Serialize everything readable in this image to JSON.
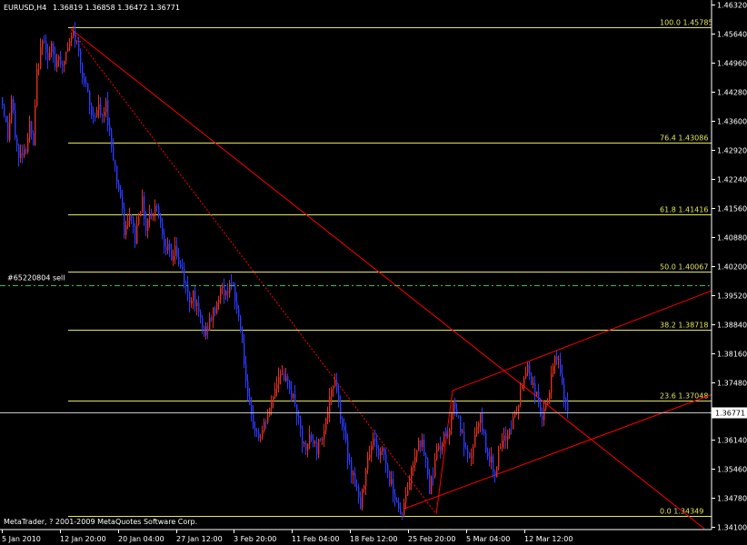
{
  "header": {
    "symbol": "EURUSD,H4",
    "ohlc": "1.36819 1.36858 1.36472 1.36771"
  },
  "footer": {
    "copyright": "MetaTrader, ? 2001-2009 MetaQuotes Software Corp."
  },
  "order_label": "#65220804 sell",
  "colors": {
    "background": "#000000",
    "axis": "#ffffff",
    "bull": "#e0301e",
    "bear": "#2a3bff",
    "fib": "#e5e55a",
    "trend": "#ff0000",
    "order": "#22c55e",
    "current": "#c8c8c8"
  },
  "chart_data": {
    "type": "candlestick",
    "title": "EURUSD,H4",
    "y_ticks": [
      "1.46320",
      "1.45640",
      "1.44960",
      "1.44280",
      "1.43600",
      "1.42920",
      "1.42240",
      "1.41560",
      "1.40880",
      "1.40200",
      "1.39520",
      "1.38840",
      "1.38160",
      "1.37480",
      "1.36800",
      "1.36140",
      "1.35460",
      "1.34780",
      "1.34100"
    ],
    "x_ticks": [
      "5 Jan 2010",
      "12 Jan 20:00",
      "20 Jan 04:00",
      "27 Jan 12:00",
      "3 Feb 20:00",
      "11 Feb 04:00",
      "18 Feb 12:00",
      "25 Feb 20:00",
      "5 Mar 04:00",
      "12 Mar 12:00"
    ],
    "ylim": [
      1.341,
      1.4632
    ],
    "fibonacci": [
      {
        "level": "100.0",
        "price": "1.45785"
      },
      {
        "level": "76.4",
        "price": "1.43086"
      },
      {
        "level": "61.8",
        "price": "1.41416"
      },
      {
        "level": "50.0",
        "price": "1.40067"
      },
      {
        "level": "38.2",
        "price": "1.38718"
      },
      {
        "level": "23.6",
        "price": "1.37048"
      },
      {
        "level": "0.0",
        "price": "1.34349"
      }
    ],
    "current_price": "1.36771",
    "order_price": "1.3975",
    "close_path": [
      [
        0,
        1.4415
      ],
      [
        4,
        1.438
      ],
      [
        8,
        1.432
      ],
      [
        12,
        1.441
      ],
      [
        16,
        1.433
      ],
      [
        20,
        1.427
      ],
      [
        24,
        1.429
      ],
      [
        28,
        1.43
      ],
      [
        32,
        1.435
      ],
      [
        36,
        1.43
      ],
      [
        40,
        1.447
      ],
      [
        44,
        1.452
      ],
      [
        48,
        1.456
      ],
      [
        52,
        1.45
      ],
      [
        56,
        1.453
      ],
      [
        60,
        1.449
      ],
      [
        64,
        1.452
      ],
      [
        68,
        1.448
      ],
      [
        72,
        1.452
      ],
      [
        76,
        1.454
      ],
      [
        80,
        1.4565
      ],
      [
        84,
        1.454
      ],
      [
        88,
        1.45
      ],
      [
        92,
        1.445
      ],
      [
        96,
        1.442
      ],
      [
        100,
        1.437
      ],
      [
        104,
        1.438
      ],
      [
        108,
        1.439
      ],
      [
        112,
        1.436
      ],
      [
        116,
        1.44
      ],
      [
        120,
        1.433
      ],
      [
        124,
        1.428
      ],
      [
        128,
        1.422
      ],
      [
        132,
        1.418
      ],
      [
        136,
        1.41
      ],
      [
        140,
        1.412
      ],
      [
        144,
        1.414
      ],
      [
        148,
        1.408
      ],
      [
        152,
        1.415
      ],
      [
        156,
        1.417
      ],
      [
        160,
        1.411
      ],
      [
        164,
        1.415
      ],
      [
        168,
        1.414
      ],
      [
        172,
        1.417
      ],
      [
        176,
        1.412
      ],
      [
        180,
        1.408
      ],
      [
        184,
        1.406
      ],
      [
        188,
        1.403
      ],
      [
        192,
        1.407
      ],
      [
        196,
        1.402
      ],
      [
        200,
        1.401
      ],
      [
        204,
        1.397
      ],
      [
        208,
        1.394
      ],
      [
        212,
        1.396
      ],
      [
        216,
        1.392
      ],
      [
        220,
        1.389
      ],
      [
        224,
        1.386
      ],
      [
        228,
        1.388
      ],
      [
        232,
        1.39
      ],
      [
        236,
        1.392
      ],
      [
        240,
        1.395
      ],
      [
        244,
        1.397
      ],
      [
        248,
        1.395
      ],
      [
        252,
        1.399
      ],
      [
        256,
        1.396
      ],
      [
        260,
        1.392
      ],
      [
        264,
        1.388
      ],
      [
        268,
        1.38
      ],
      [
        272,
        1.37
      ],
      [
        276,
        1.366
      ],
      [
        280,
        1.364
      ],
      [
        284,
        1.362
      ],
      [
        288,
        1.363
      ],
      [
        292,
        1.366
      ],
      [
        296,
        1.368
      ],
      [
        300,
        1.372
      ],
      [
        304,
        1.375
      ],
      [
        308,
        1.378
      ],
      [
        312,
        1.374
      ],
      [
        316,
        1.376
      ],
      [
        320,
        1.372
      ],
      [
        324,
        1.37
      ],
      [
        328,
        1.365
      ],
      [
        332,
        1.361
      ],
      [
        336,
        1.358
      ],
      [
        340,
        1.362
      ],
      [
        344,
        1.361
      ],
      [
        348,
        1.359
      ],
      [
        352,
        1.362
      ],
      [
        356,
        1.364
      ],
      [
        360,
        1.368
      ],
      [
        364,
        1.372
      ],
      [
        368,
        1.376
      ],
      [
        372,
        1.37
      ],
      [
        376,
        1.365
      ],
      [
        380,
        1.36
      ],
      [
        384,
        1.356
      ],
      [
        388,
        1.353
      ],
      [
        392,
        1.35
      ],
      [
        396,
        1.345
      ],
      [
        400,
        1.352
      ],
      [
        404,
        1.358
      ],
      [
        408,
        1.36
      ],
      [
        412,
        1.362
      ],
      [
        416,
        1.357
      ],
      [
        420,
        1.36
      ],
      [
        424,
        1.356
      ],
      [
        428,
        1.352
      ],
      [
        432,
        1.35
      ],
      [
        436,
        1.347
      ],
      [
        440,
        1.344
      ],
      [
        444,
        1.346
      ],
      [
        448,
        1.35
      ],
      [
        452,
        1.354
      ],
      [
        456,
        1.358
      ],
      [
        460,
        1.362
      ],
      [
        464,
        1.36
      ],
      [
        468,
        1.356
      ],
      [
        472,
        1.35
      ],
      [
        476,
        1.354
      ],
      [
        480,
        1.36
      ],
      [
        484,
        1.358
      ],
      [
        488,
        1.364
      ],
      [
        492,
        1.362
      ],
      [
        496,
        1.368
      ],
      [
        500,
        1.37
      ],
      [
        504,
        1.366
      ],
      [
        508,
        1.362
      ],
      [
        512,
        1.358
      ],
      [
        516,
        1.356
      ],
      [
        520,
        1.36
      ],
      [
        524,
        1.364
      ],
      [
        528,
        1.366
      ],
      [
        532,
        1.362
      ],
      [
        536,
        1.358
      ],
      [
        540,
        1.356
      ],
      [
        544,
        1.354
      ],
      [
        548,
        1.358
      ],
      [
        552,
        1.36
      ],
      [
        556,
        1.362
      ],
      [
        560,
        1.364
      ],
      [
        564,
        1.366
      ],
      [
        568,
        1.368
      ],
      [
        572,
        1.372
      ],
      [
        576,
        1.376
      ],
      [
        580,
        1.379
      ],
      [
        584,
        1.375
      ],
      [
        588,
        1.373
      ],
      [
        592,
        1.37
      ],
      [
        596,
        1.366
      ],
      [
        600,
        1.369
      ],
      [
        604,
        1.373
      ],
      [
        608,
        1.378
      ],
      [
        612,
        1.381
      ],
      [
        616,
        1.378
      ],
      [
        620,
        1.37
      ],
      [
        624,
        1.3677
      ]
    ]
  }
}
